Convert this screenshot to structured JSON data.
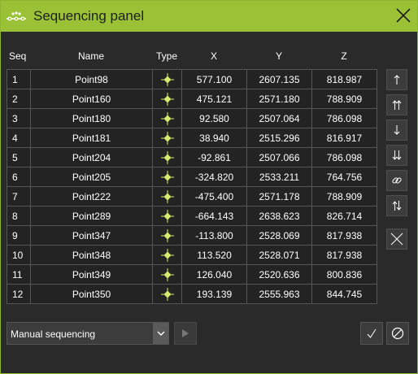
{
  "window": {
    "title": "Sequencing panel"
  },
  "columns": {
    "seq": "Seq",
    "name": "Name",
    "type": "Type",
    "x": "X",
    "y": "Y",
    "z": "Z"
  },
  "rows": [
    {
      "seq": "1",
      "name": "Point98",
      "type_icon": "point-type-icon",
      "x": "577.100",
      "y": "2607.135",
      "z": "818.987"
    },
    {
      "seq": "2",
      "name": "Point160",
      "type_icon": "point-type-icon",
      "x": "475.121",
      "y": "2571.180",
      "z": "788.909"
    },
    {
      "seq": "3",
      "name": "Point180",
      "type_icon": "point-type-icon",
      "x": "92.580",
      "y": "2507.064",
      "z": "786.098"
    },
    {
      "seq": "4",
      "name": "Point181",
      "type_icon": "point-type-icon",
      "x": "38.940",
      "y": "2515.296",
      "z": "816.917"
    },
    {
      "seq": "5",
      "name": "Point204",
      "type_icon": "point-type-icon",
      "x": "-92.861",
      "y": "2507.066",
      "z": "786.098"
    },
    {
      "seq": "6",
      "name": "Point205",
      "type_icon": "point-type-icon",
      "x": "-324.820",
      "y": "2533.211",
      "z": "764.756"
    },
    {
      "seq": "7",
      "name": "Point222",
      "type_icon": "point-type-icon",
      "x": "-475.400",
      "y": "2571.178",
      "z": "788.909"
    },
    {
      "seq": "8",
      "name": "Point289",
      "type_icon": "point-type-icon",
      "x": "-664.143",
      "y": "2638.623",
      "z": "826.714"
    },
    {
      "seq": "9",
      "name": "Point347",
      "type_icon": "point-type-icon",
      "x": "-113.800",
      "y": "2528.069",
      "z": "817.938"
    },
    {
      "seq": "10",
      "name": "Point348",
      "type_icon": "point-type-icon",
      "x": "113.520",
      "y": "2528.071",
      "z": "817.938"
    },
    {
      "seq": "11",
      "name": "Point349",
      "type_icon": "point-type-icon",
      "x": "126.040",
      "y": "2520.636",
      "z": "800.836"
    },
    {
      "seq": "12",
      "name": "Point350",
      "type_icon": "point-type-icon",
      "x": "193.139",
      "y": "2555.963",
      "z": "844.745"
    }
  ],
  "side_buttons": [
    "move-up-icon",
    "move-to-top-icon",
    "move-down-icon",
    "move-to-bottom-icon",
    "link-icon",
    "swap-icon",
    "remove-icon"
  ],
  "footer": {
    "mode_select": {
      "value": "Manual sequencing"
    },
    "buttons": [
      "play-icon",
      "confirm-icon",
      "cancel-icon"
    ]
  },
  "colors": {
    "accent": "#9bc237",
    "background": "#2a2a2a",
    "cell_background": "#232323",
    "grid_line": "#555555",
    "point_icon": "#d7ec6a"
  }
}
